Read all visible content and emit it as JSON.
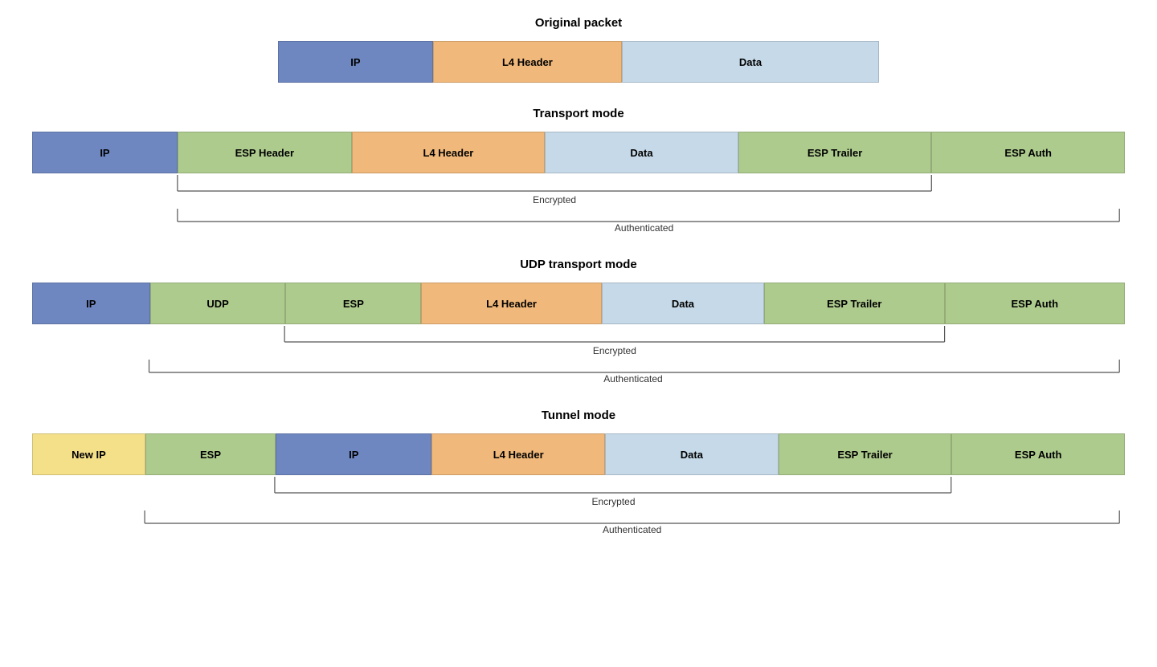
{
  "original_packet": {
    "title": "Original packet",
    "cells": [
      {
        "label": "IP",
        "color": "blue",
        "class": "orig-ip"
      },
      {
        "label": "L4 Header",
        "color": "orange",
        "class": "orig-l4"
      },
      {
        "label": "Data",
        "color": "ltblue",
        "class": "orig-data"
      }
    ]
  },
  "transport_mode": {
    "title": "Transport mode",
    "cells": [
      {
        "label": "IP",
        "color": "blue",
        "class": "tr-ip"
      },
      {
        "label": "ESP Header",
        "color": "green",
        "class": "tr-esph"
      },
      {
        "label": "L4 Header",
        "color": "orange",
        "class": "tr-l4"
      },
      {
        "label": "Data",
        "color": "ltblue",
        "class": "tr-data"
      },
      {
        "label": "ESP Trailer",
        "color": "green",
        "class": "tr-espt"
      },
      {
        "label": "ESP Auth",
        "color": "green",
        "class": "tr-espa"
      }
    ],
    "encrypted_label": "Encrypted",
    "authenticated_label": "Authenticated"
  },
  "udp_transport_mode": {
    "title": "UDP transport mode",
    "cells": [
      {
        "label": "IP",
        "color": "blue",
        "class": "udp-ip"
      },
      {
        "label": "UDP",
        "color": "green",
        "class": "udp-udp"
      },
      {
        "label": "ESP",
        "color": "green",
        "class": "udp-esp"
      },
      {
        "label": "L4 Header",
        "color": "orange",
        "class": "udp-l4"
      },
      {
        "label": "Data",
        "color": "ltblue",
        "class": "udp-data"
      },
      {
        "label": "ESP Trailer",
        "color": "green",
        "class": "udp-espt"
      },
      {
        "label": "ESP Auth",
        "color": "green",
        "class": "udp-espa"
      }
    ],
    "encrypted_label": "Encrypted",
    "authenticated_label": "Authenticated"
  },
  "tunnel_mode": {
    "title": "Tunnel mode",
    "cells": [
      {
        "label": "New IP",
        "color": "yellow",
        "class": "tun-newip"
      },
      {
        "label": "ESP",
        "color": "green",
        "class": "tun-esp"
      },
      {
        "label": "IP",
        "color": "blue",
        "class": "tun-ip"
      },
      {
        "label": "L4 Header",
        "color": "orange",
        "class": "tun-l4"
      },
      {
        "label": "Data",
        "color": "ltblue",
        "class": "tun-data"
      },
      {
        "label": "ESP Trailer",
        "color": "green",
        "class": "tun-espt"
      },
      {
        "label": "ESP Auth",
        "color": "green",
        "class": "tun-espa"
      }
    ],
    "encrypted_label": "Encrypted",
    "authenticated_label": "Authenticated"
  }
}
